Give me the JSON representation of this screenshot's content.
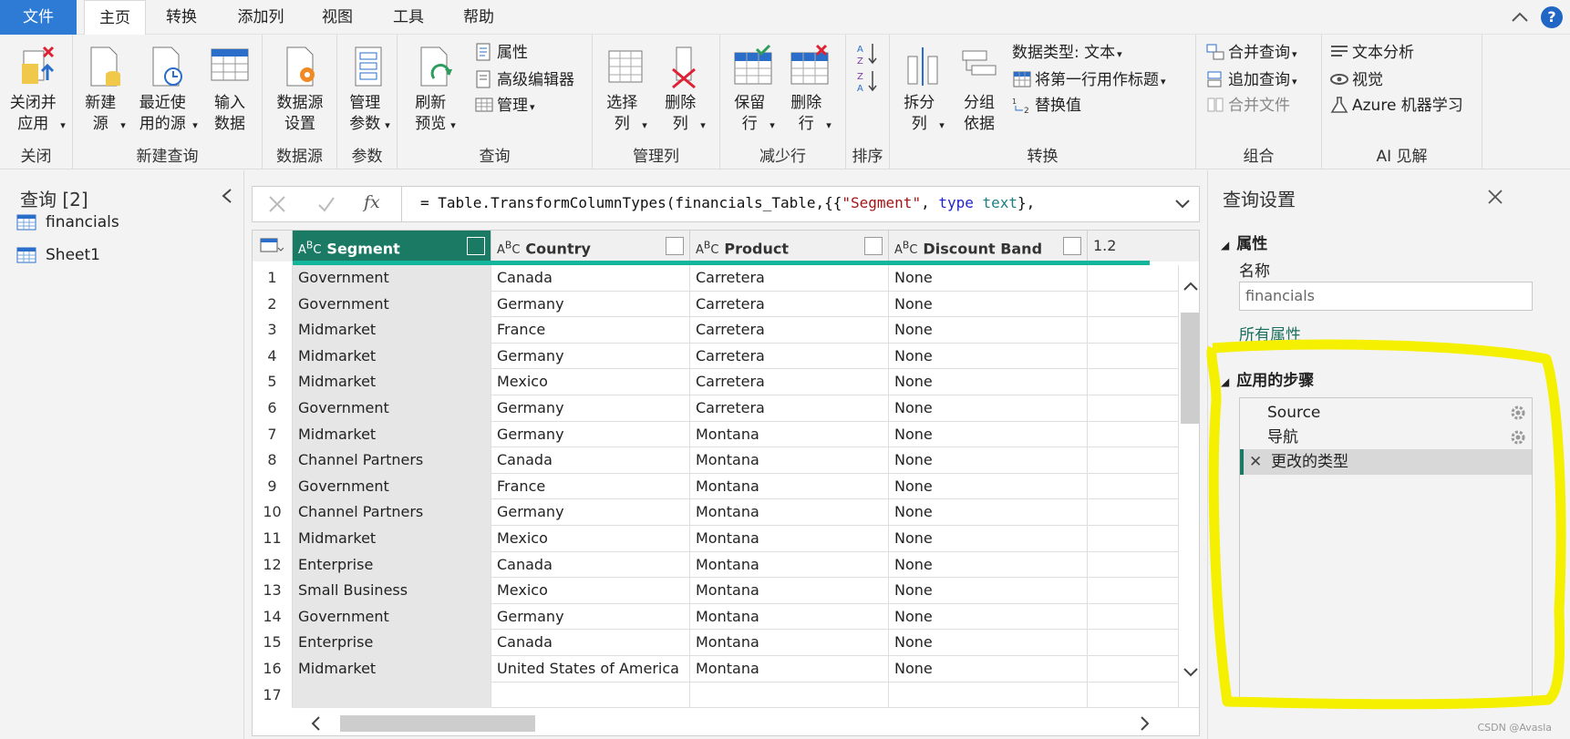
{
  "tabs": [
    "文件",
    "主页",
    "转换",
    "添加列",
    "视图",
    "工具",
    "帮助"
  ],
  "ribbon": {
    "close": {
      "btn": "关闭并应用",
      "group": "关闭"
    },
    "newquery": {
      "new_source": "新建源",
      "recent": "最近使用的源",
      "enter": "输入数据",
      "group": "新建查询"
    },
    "datasource": {
      "settings": "数据源设置",
      "group": "数据源"
    },
    "params": {
      "manage": "管理参数",
      "group": "参数"
    },
    "query": {
      "refresh": "刷新预览",
      "props": "属性",
      "advanced": "高级编辑器",
      "manage": "管理",
      "group": "查询"
    },
    "managecols": {
      "choose": "选择列",
      "remove": "删除列",
      "group": "管理列"
    },
    "reducerows": {
      "keep": "保留行",
      "remove": "删除行",
      "group": "减少行"
    },
    "sort": {
      "group": "排序"
    },
    "transform": {
      "split": "拆分列",
      "groupby": "分组依据",
      "datatype": "数据类型: 文本",
      "firstrow": "将第一行用作标题",
      "replace": "替换值",
      "group": "转换"
    },
    "combine": {
      "merge": "合并查询",
      "append": "追加查询",
      "mergefiles": "合并文件",
      "group": "组合"
    },
    "ai": {
      "text": "文本分析",
      "vision": "视觉",
      "azure": "Azure 机器学习",
      "group": "AI 见解"
    }
  },
  "left": {
    "title": "查询 [2]",
    "queries": [
      "financials",
      "Sheet1"
    ]
  },
  "formula": {
    "prefix": "= Table.TransformColumnTypes(financials_Table,{{",
    "seg": "\"Segment\"",
    "comma": ", ",
    "type": "type",
    "text": "text",
    "suffix": "},"
  },
  "grid": {
    "columns": [
      "Segment",
      "Country",
      "Product",
      "Discount Band"
    ],
    "next_col": "1.2",
    "rows": [
      [
        "1",
        "Government",
        "Canada",
        "Carretera",
        "None"
      ],
      [
        "2",
        "Government",
        "Germany",
        "Carretera",
        "None"
      ],
      [
        "3",
        "Midmarket",
        "France",
        "Carretera",
        "None"
      ],
      [
        "4",
        "Midmarket",
        "Germany",
        "Carretera",
        "None"
      ],
      [
        "5",
        "Midmarket",
        "Mexico",
        "Carretera",
        "None"
      ],
      [
        "6",
        "Government",
        "Germany",
        "Carretera",
        "None"
      ],
      [
        "7",
        "Midmarket",
        "Germany",
        "Montana",
        "None"
      ],
      [
        "8",
        "Channel Partners",
        "Canada",
        "Montana",
        "None"
      ],
      [
        "9",
        "Government",
        "France",
        "Montana",
        "None"
      ],
      [
        "10",
        "Channel Partners",
        "Germany",
        "Montana",
        "None"
      ],
      [
        "11",
        "Midmarket",
        "Mexico",
        "Montana",
        "None"
      ],
      [
        "12",
        "Enterprise",
        "Canada",
        "Montana",
        "None"
      ],
      [
        "13",
        "Small Business",
        "Mexico",
        "Montana",
        "None"
      ],
      [
        "14",
        "Government",
        "Germany",
        "Montana",
        "None"
      ],
      [
        "15",
        "Enterprise",
        "Canada",
        "Montana",
        "None"
      ],
      [
        "16",
        "Midmarket",
        "United States of America",
        "Montana",
        "None"
      ],
      [
        "17",
        "",
        "",
        "",
        ""
      ]
    ]
  },
  "right": {
    "title": "查询设置",
    "props": "属性",
    "name_label": "名称",
    "name_value": "financials",
    "all_props": "所有属性",
    "steps_title": "应用的步骤",
    "steps": [
      "Source",
      "导航",
      "更改的类型"
    ]
  },
  "watermark": "CSDN @Avasla"
}
